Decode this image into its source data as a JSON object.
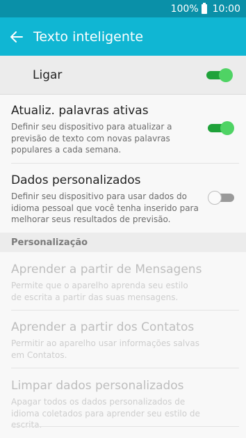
{
  "status_bar": {
    "battery_percent": "100%",
    "time": "10:00"
  },
  "app_bar": {
    "title": "Texto inteligente"
  },
  "master": {
    "label": "Ligar",
    "enabled": true
  },
  "settings": [
    {
      "title": "Atualiz. palavras ativas",
      "description": "Definir seu dispositivo para atualizar a previsão de texto com novas palavras populares a cada semana.",
      "enabled": true
    },
    {
      "title": "Dados personalizados",
      "description": "Definir seu dispositivo para usar dados do idioma pessoal que você tenha inserido para melhorar seus resultados de previsão.",
      "enabled": false
    }
  ],
  "section": {
    "header": "Personalização"
  },
  "personalization": [
    {
      "title": "Aprender a partir de Mensagens",
      "description": "Permite que o aparelho aprenda seu estilo de escrita a partir das suas mensagens."
    },
    {
      "title": "Aprender a partir dos Contatos",
      "description": "Permitir ao aparelho usar informações salvas em Contatos."
    },
    {
      "title": "Limpar dados personalizados",
      "description": "Apagar todos os dados personalizados de idioma coletados para aprender seu estilo de escrita."
    }
  ]
}
